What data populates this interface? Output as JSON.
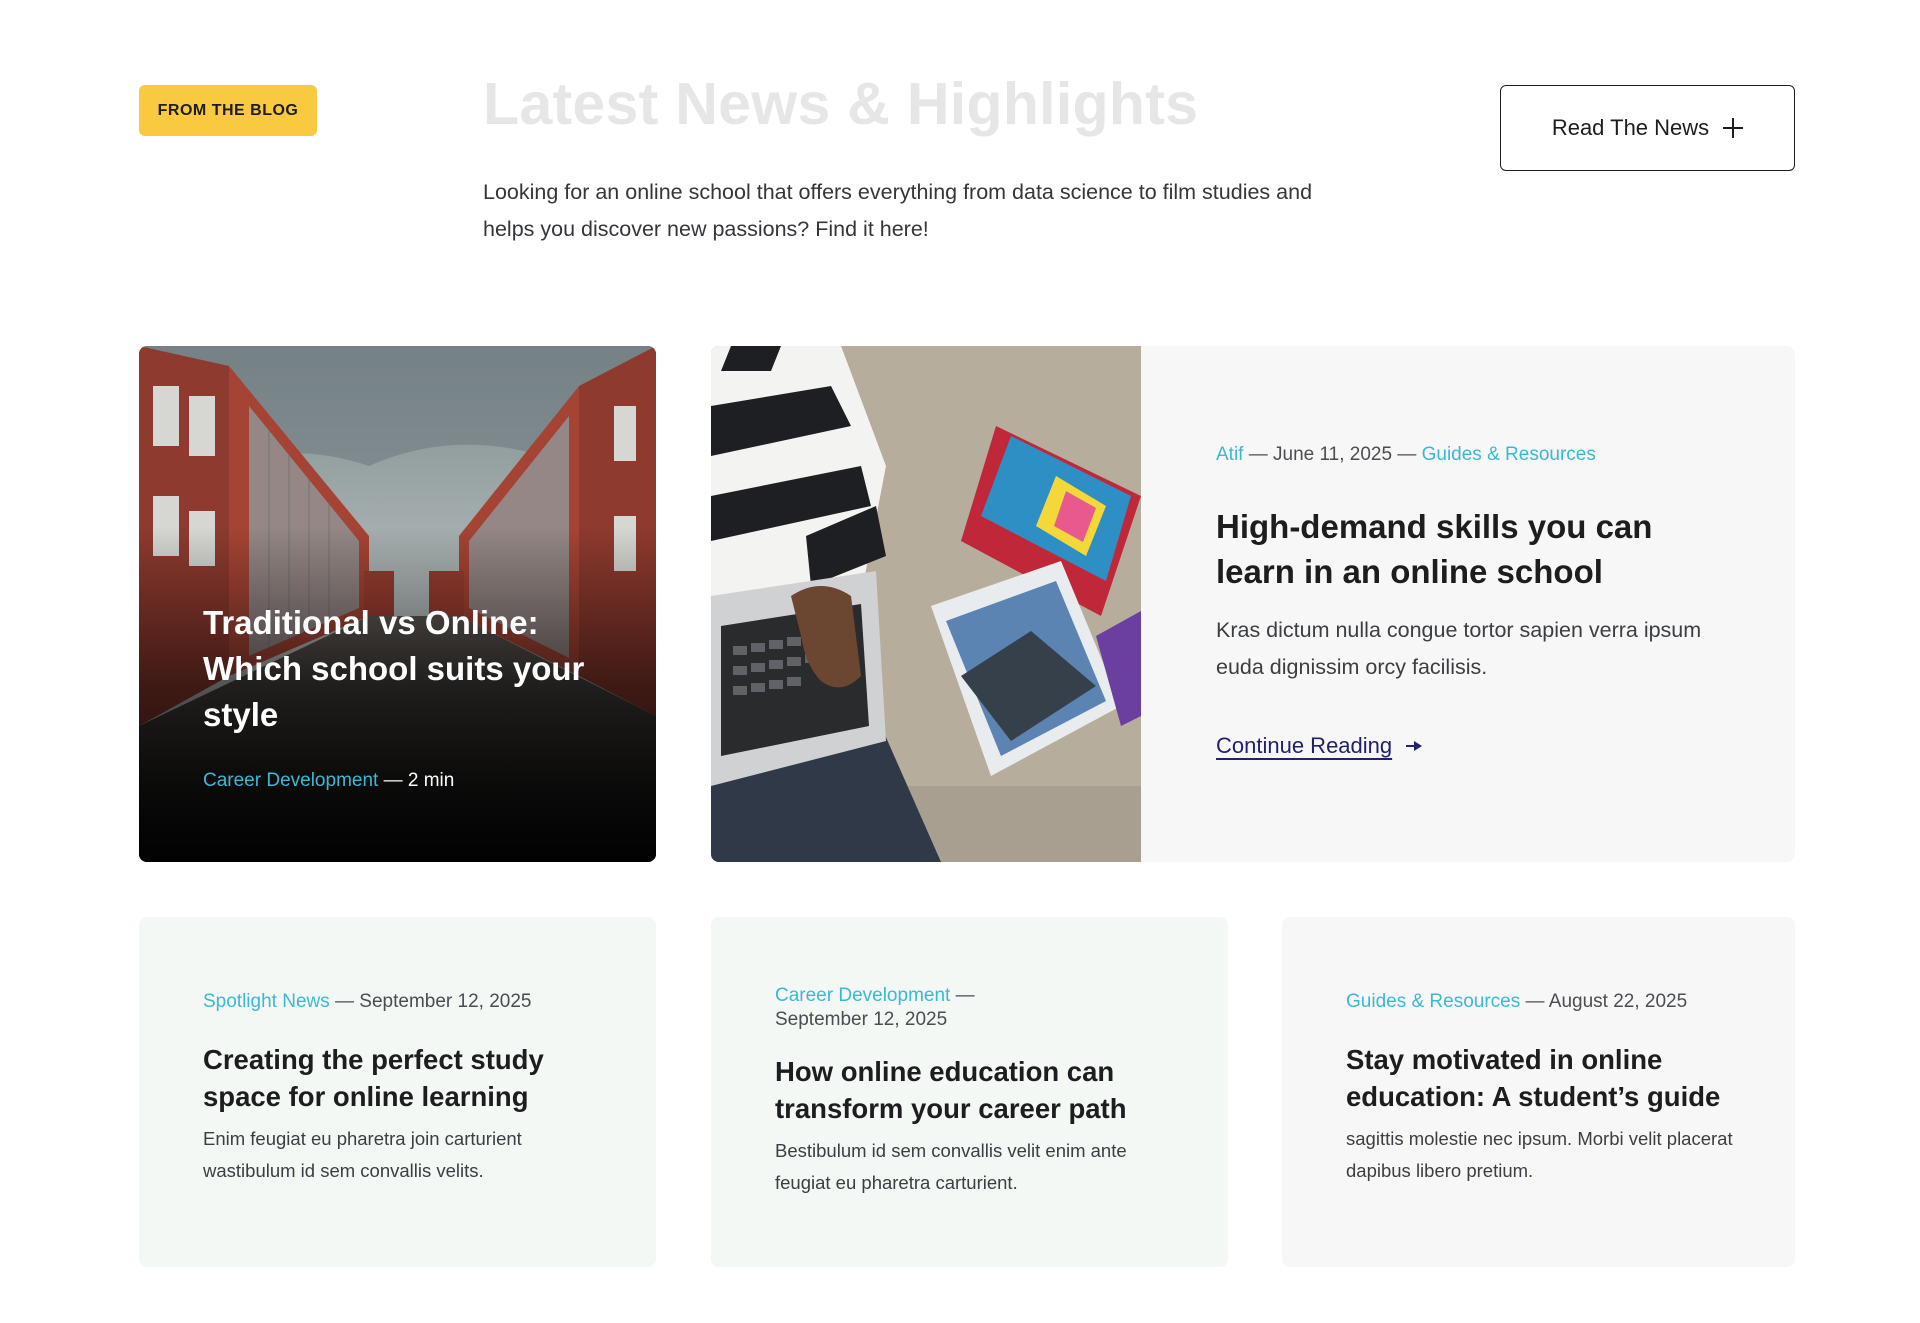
{
  "header": {
    "badge": "FROM THE BLOG",
    "title": "Latest News & Highlights",
    "description": "Looking for an online school that offers everything from data science to film studies and helps you discover new passions? Find it here!",
    "cta_label": "Read The News",
    "cta_icon": "plus-icon"
  },
  "hero_post": {
    "title": "Traditional vs Online: Which school suits your style",
    "category": "Career Development",
    "separator": "—",
    "read_time": "2 min"
  },
  "featured_post": {
    "author": "Atif",
    "separator": "—",
    "date": "June 11, 2025",
    "category": "Guides & Resources",
    "title": "High-demand skills you can learn in an online school",
    "excerpt": "Kras dictum nulla congue tortor sapien verra ipsum euda dignissim orcy facilisis.",
    "link_label": "Continue Reading",
    "link_icon": "arrow-right-icon"
  },
  "posts": [
    {
      "category": "Spotlight News",
      "separator": "—",
      "date": "September 12, 2025",
      "title": "Creating the perfect study space for online learning",
      "excerpt": "Enim feugiat eu pharetra join carturient wastibulum id sem convallis velits."
    },
    {
      "category": "Career Development",
      "separator": "—",
      "date": "September 12, 2025",
      "title": "How online education can transform your career path",
      "excerpt": "Bestibulum id sem convallis velit enim ante feugiat eu pharetra carturient."
    },
    {
      "category": "Guides & Resources",
      "separator": "—",
      "date": "August 22, 2025",
      "title": "Stay motivated in online education: A student’s guide",
      "excerpt": "sagittis molestie nec ipsum. Morbi velit placerat dapibus libero pretium."
    }
  ],
  "colors": {
    "badge": "#f9c93f",
    "accent_link": "#3bb8d6",
    "continue_link": "#22226b",
    "card_green": "#f3f8f4",
    "card_gray": "#f7f7f7"
  }
}
